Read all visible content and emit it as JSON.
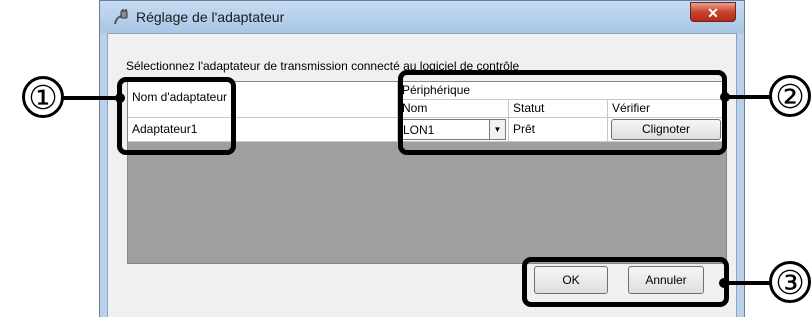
{
  "window": {
    "title": "Réglage de l'adaptateur",
    "close_glyph": "✕"
  },
  "instruction": "Sélectionnez l'adaptateur de transmission connecté au logiciel de contrôle",
  "grid": {
    "adapter_column_header": "Nom d'adaptateur",
    "group_header": "Périphérique",
    "columns": [
      "Nom",
      "Statut",
      "Vérifier"
    ],
    "rows": [
      {
        "adapter": "Adaptateur1",
        "nom": "LON1",
        "statut": "Prêt",
        "verifier_button": "Clignoter"
      }
    ]
  },
  "buttons": {
    "ok": "OK",
    "cancel": "Annuler"
  },
  "callouts": [
    "①",
    "②",
    "③"
  ],
  "icons": {
    "title": "adapter-plug-icon",
    "dropdown": "chevron-down-icon"
  }
}
